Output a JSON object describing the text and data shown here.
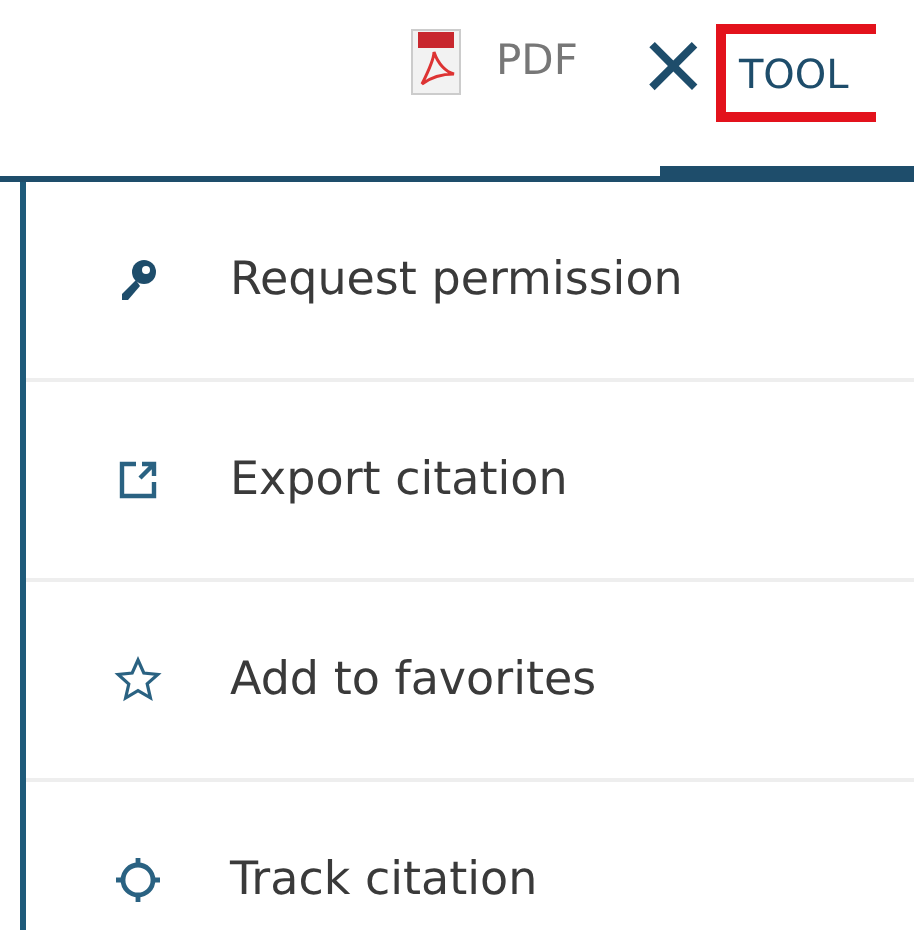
{
  "toolbar": {
    "pdf_label": "PDF",
    "close_glyph": "×",
    "tools_label": "TOOL"
  },
  "menu": {
    "items": [
      {
        "kind": "key",
        "label": "Request permission"
      },
      {
        "kind": "export",
        "label": "Export citation"
      },
      {
        "kind": "star",
        "label": "Add to favorites"
      },
      {
        "kind": "target",
        "label": "Track citation"
      }
    ]
  }
}
